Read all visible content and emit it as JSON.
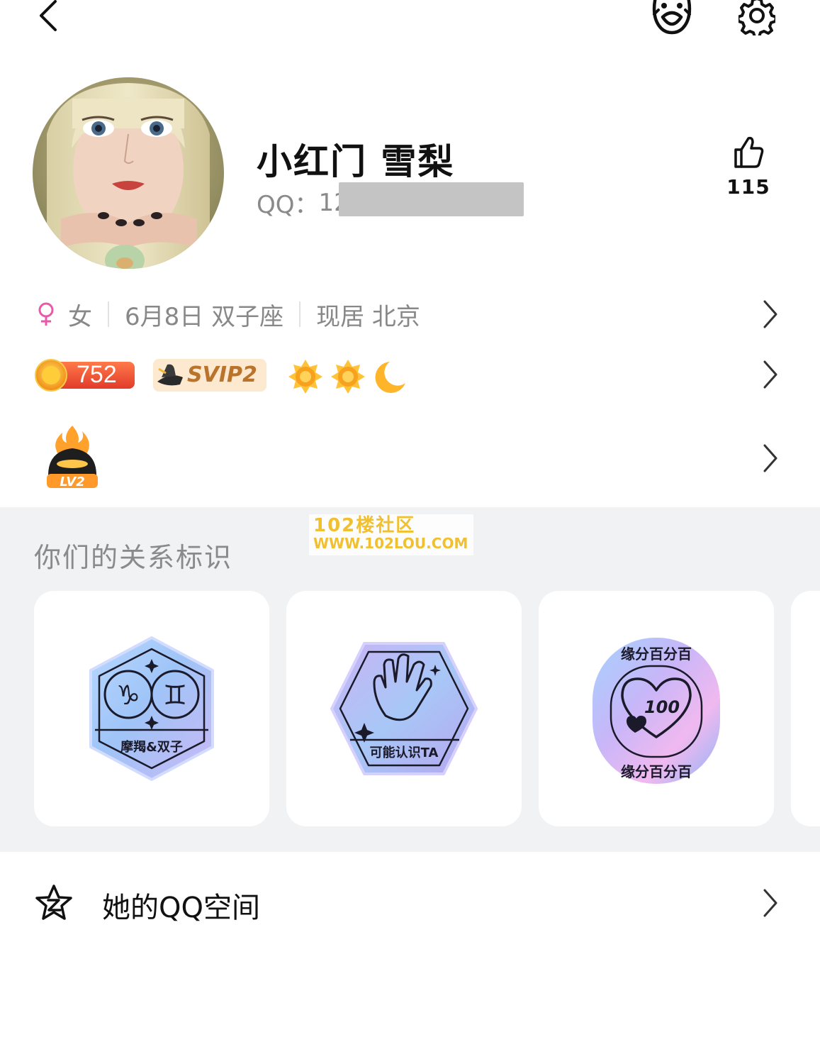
{
  "profile": {
    "nickname": "小红门 雪梨",
    "qq_prefix": "QQ：",
    "qq_partial": "12",
    "likes": "115"
  },
  "basic_info": {
    "gender": "女",
    "birthday": "6月8日 双子座",
    "location": "现居 北京"
  },
  "badges": {
    "level_value": "752",
    "svip": "SVIP2"
  },
  "game_level": "LV2",
  "relation": {
    "title": "你们的关系标识",
    "cards": [
      {
        "label": "摩羯&双子"
      },
      {
        "label": "可能认识TA"
      },
      {
        "label_top": "缘分百分百",
        "label_bottom": "缘分百分百",
        "number": "100"
      }
    ]
  },
  "watermark": {
    "line1": "102楼社区",
    "line2": "WWW.102LOU.COM"
  },
  "qzone": {
    "label": "她的QQ空间"
  },
  "colors": {
    "gender_pink": "#e85aa8",
    "svip_gold": "#b9732a",
    "badge_red": "#f2543a"
  }
}
